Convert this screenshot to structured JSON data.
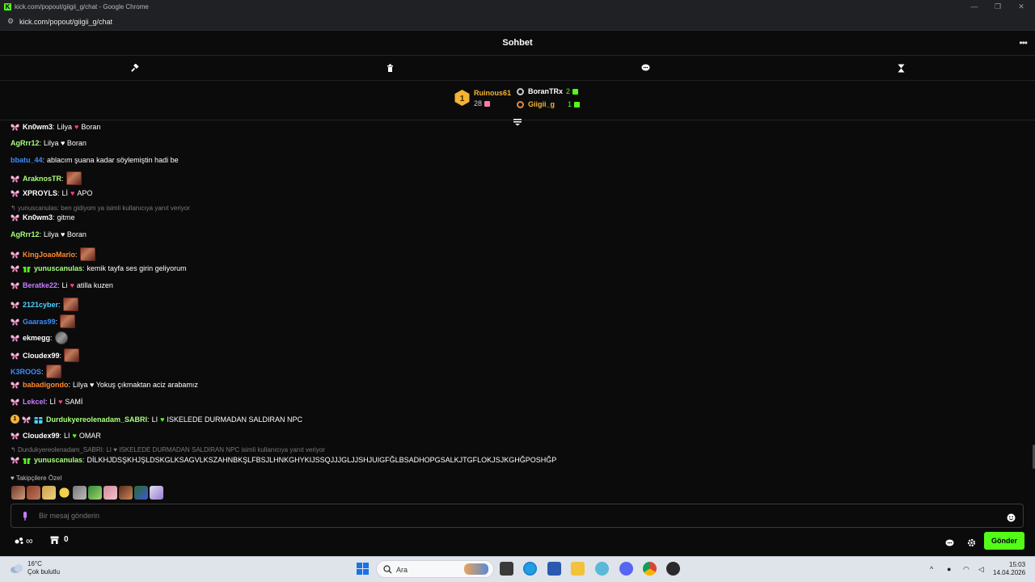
{
  "window": {
    "title": "kick.com/popout/giigii_g/chat - Google Chrome",
    "url": "kick.com/popout/giigii_g/chat"
  },
  "header": {
    "title": "Sohbet",
    "more_label": "•••"
  },
  "leaderboard": {
    "first": {
      "rank": "1",
      "name": "Ruinous61",
      "count": "28"
    },
    "others": [
      {
        "name": "BoranTRx",
        "count": "2",
        "color": "#ffffff"
      },
      {
        "name": "Giigii_g",
        "count": "1",
        "color": "#f5b335"
      }
    ]
  },
  "messages": [
    {
      "user": "Kn0wm3",
      "color": "#ffffff",
      "badges": [
        "butterfly"
      ],
      "parts": [
        "Lilya",
        "heart",
        "Boran"
      ]
    },
    {
      "user": "AgRrr12",
      "color": "#a8ff7a",
      "badges": [],
      "parts": [
        "Lilya ♥ Boran"
      ]
    },
    {
      "user": "bbatu_44",
      "color": "#3b8cff",
      "badges": [],
      "parts": [
        "ablacım şuana kadar söylemiştin hadi be"
      ]
    },
    {
      "user": "AraknosTR",
      "color": "#a8ff7a",
      "badges": [
        "butterfly"
      ],
      "parts": [
        "emote"
      ]
    },
    {
      "user": "XPROYLS",
      "color": "#ffffff",
      "badges": [
        "butterfly"
      ],
      "parts": [
        "Lİ",
        "heart",
        "APO"
      ]
    },
    {
      "reply": "yunuscanulas: ben gidiyom ya isimli kullanıcıya yanıt veriyor"
    },
    {
      "user": "Kn0wm3",
      "color": "#ffffff",
      "badges": [
        "butterfly"
      ],
      "parts": [
        "gitme"
      ]
    },
    {
      "user": "AgRrr12",
      "color": "#a8ff7a",
      "badges": [],
      "parts": [
        "Lilya ♥ Boran"
      ]
    },
    {
      "user": "KingJoaoMario",
      "color": "#ff8a2a",
      "badges": [
        "butterfly"
      ],
      "parts": [
        "emote"
      ]
    },
    {
      "user": "yunuscanulas",
      "color": "#a8ff7a",
      "badges": [
        "butterfly",
        "gift"
      ],
      "parts": [
        "kemik tayfa ses girin geliyorum"
      ]
    },
    {
      "user": "Beratke22",
      "color": "#c77dff",
      "badges": [
        "butterfly"
      ],
      "parts": [
        "Li",
        "heart",
        "atilla kuzen"
      ]
    },
    {
      "user": "2121cyber",
      "color": "#4fd1ff",
      "badges": [
        "butterfly"
      ],
      "parts": [
        "emote"
      ]
    },
    {
      "user": "Gaaras99",
      "color": "#3b8cff",
      "badges": [
        "butterfly"
      ],
      "parts": [
        "emote"
      ]
    },
    {
      "user": "ekmegg",
      "color": "#ffffff",
      "badges": [
        "butterfly"
      ],
      "parts": [
        "emote-gray"
      ]
    },
    {
      "user": "Cloudex99",
      "color": "#ffffff",
      "badges": [
        "butterfly"
      ],
      "parts": [
        "emote"
      ]
    },
    {
      "user": "K3ROOS",
      "color": "#3b8cff",
      "badges": [],
      "parts": [
        "emote"
      ]
    },
    {
      "user": "babadigondo",
      "color": "#ff8a2a",
      "badges": [
        "butterfly"
      ],
      "parts": [
        "Lilya ♥ Yokuş çıkmaktan aciz arabamız"
      ]
    },
    {
      "user": "Lekcel",
      "color": "#c77dff",
      "badges": [
        "butterfly"
      ],
      "parts": [
        "Lİ",
        "heart",
        "SAMİ"
      ]
    },
    {
      "user": "Durdukyereolenadam_SABRI",
      "color": "#a8ff7a",
      "badges": [
        "sub",
        "butterfly",
        "giftbox"
      ],
      "parts": [
        "LI",
        "heart-green",
        "ISKELEDE DURMADAN SALDIRAN NPC"
      ]
    },
    {
      "user": "Cloudex99",
      "color": "#ffffff",
      "badges": [
        "butterfly"
      ],
      "parts": [
        "LI",
        "heart-green",
        "OMAR"
      ]
    },
    {
      "reply": "Durdukyereolenadam_SABRI: LI ♥ ISKELEDE DURMADAN SALDIRAN NPC isimli kullanıcıya yanıt veriyor"
    },
    {
      "user": "yunuscanulas",
      "color": "#a8ff7a",
      "badges": [
        "butterfly",
        "gift"
      ],
      "parts": [
        "DİLKHJDSŞKHJŞLDSKGLKSAGVLKSZAHNBKŞLFBSJLHNKGHYKIJSSQJJJGLJJSHJUIGFĞLBSADHOPGSALKJTGFLOKJSJKGHĞPOSHĞP"
      ]
    }
  ],
  "followers_only": {
    "label": "Takipçilere Özel"
  },
  "composer": {
    "placeholder": "Bir mesaj gönderin"
  },
  "footer": {
    "infinity": "∞",
    "points": "0",
    "send_label": "Gönder"
  },
  "taskbar": {
    "temp": "16°C",
    "weather": "Çok bulutlu",
    "search_label": "Ara",
    "time": "15:03",
    "date": "14.04.2026"
  },
  "colors": {
    "accent": "#53fc18",
    "gold": "#f5b335"
  }
}
